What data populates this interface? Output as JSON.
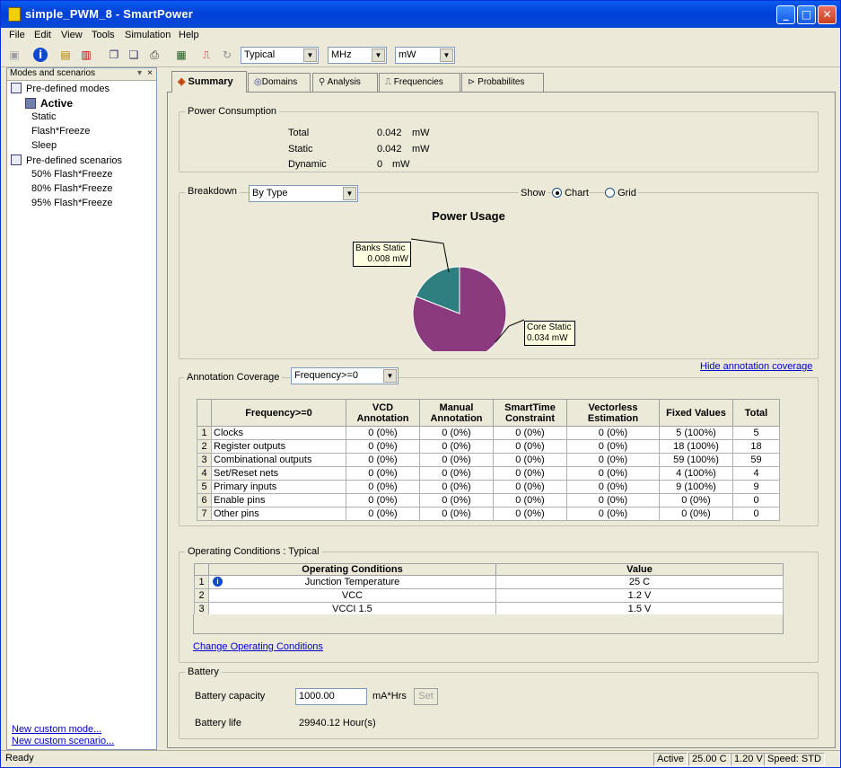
{
  "window": {
    "title": "simple_PWM_8 - SmartPower",
    "min": "_",
    "max": "□",
    "close": "✕"
  },
  "menu": [
    "File",
    "Edit",
    "View",
    "Tools",
    "Simulation",
    "Help"
  ],
  "toolbar": {
    "corner": "Typical",
    "freq_unit": "MHz",
    "power_unit": "mW"
  },
  "left": {
    "header": "Modes and scenarios",
    "modes_title": "Pre-defined modes",
    "modes": [
      "Active",
      "Static",
      "Flash*Freeze",
      "Sleep"
    ],
    "scenarios_title": "Pre-defined scenarios",
    "scenarios": [
      "50% Flash*Freeze",
      "80% Flash*Freeze",
      "95% Flash*Freeze"
    ],
    "new_mode": "New custom mode...",
    "new_scenario": "New custom scenario..."
  },
  "tabs": [
    "Summary",
    "Domains",
    "Analysis",
    "Frequencies",
    "Probabilites"
  ],
  "power": {
    "legend": "Power Consumption",
    "rows": [
      {
        "label": "Total",
        "value": "0.042",
        "unit": "mW"
      },
      {
        "label": "Static",
        "value": "0.042",
        "unit": "mW"
      },
      {
        "label": "Dynamic",
        "value": "0",
        "unit": "mW"
      }
    ]
  },
  "breakdown": {
    "legend": "Breakdown",
    "by": "By Type",
    "show": "Show",
    "opt_chart": "Chart",
    "opt_grid": "Grid",
    "hide_link": "Hide annotation coverage"
  },
  "chart_data": {
    "type": "pie",
    "title": "Power Usage",
    "slices": [
      {
        "name": "Core Static",
        "value": 0.034,
        "label": "0.034 mW",
        "color": "#8b3a7e"
      },
      {
        "name": "Banks Static",
        "value": 0.008,
        "label": "0.008 mW",
        "color": "#2e7f7f"
      }
    ]
  },
  "annotation": {
    "legend": "Annotation Coverage",
    "filter": "Frequency>=0",
    "headers": [
      "Frequency>=0",
      "VCD Annotation",
      "Manual Annotation",
      "SmartTime Constraint",
      "Vectorless Estimation",
      "Fixed Values",
      "Total"
    ],
    "rows": [
      [
        "1",
        "Clocks",
        "0 (0%)",
        "0 (0%)",
        "0 (0%)",
        "0 (0%)",
        "5 (100%)",
        "5"
      ],
      [
        "2",
        "Register outputs",
        "0 (0%)",
        "0 (0%)",
        "0 (0%)",
        "0 (0%)",
        "18 (100%)",
        "18"
      ],
      [
        "3",
        "Combinational outputs",
        "0 (0%)",
        "0 (0%)",
        "0 (0%)",
        "0 (0%)",
        "59 (100%)",
        "59"
      ],
      [
        "4",
        "Set/Reset nets",
        "0 (0%)",
        "0 (0%)",
        "0 (0%)",
        "0 (0%)",
        "4 (100%)",
        "4"
      ],
      [
        "5",
        "Primary inputs",
        "0 (0%)",
        "0 (0%)",
        "0 (0%)",
        "0 (0%)",
        "9 (100%)",
        "9"
      ],
      [
        "6",
        "Enable pins",
        "0 (0%)",
        "0 (0%)",
        "0 (0%)",
        "0 (0%)",
        "0 (0%)",
        "0"
      ],
      [
        "7",
        "Other pins",
        "0 (0%)",
        "0 (0%)",
        "0 (0%)",
        "0 (0%)",
        "0 (0%)",
        "0"
      ]
    ]
  },
  "operating": {
    "legend": "Operating Conditions : Typical",
    "headers": [
      "Operating Conditions",
      "Value"
    ],
    "rows": [
      [
        "1",
        "Junction Temperature",
        "25 C"
      ],
      [
        "2",
        "VCC",
        "1.2 V"
      ],
      [
        "3",
        "VCCI 1.5",
        "1.5 V"
      ]
    ],
    "change_link": "Change Operating Conditions"
  },
  "battery": {
    "legend": "Battery",
    "capacity_label": "Battery capacity",
    "capacity_value": "1000.00",
    "capacity_unit": "mA*Hrs",
    "set": "Set",
    "life_label": "Battery life",
    "life_value": "29940.12 Hour(s)"
  },
  "status": {
    "ready": "Ready",
    "mode": "Active",
    "temp": "25.00 C",
    "volt": "1.20 V",
    "speed": "Speed: STD"
  }
}
